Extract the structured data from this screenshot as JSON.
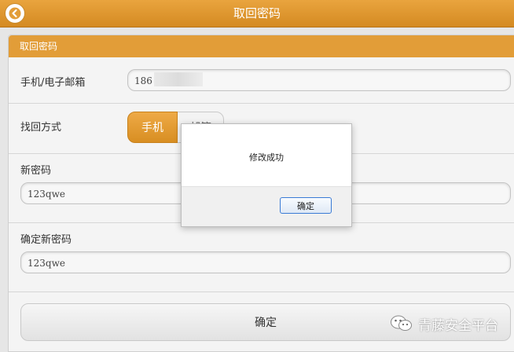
{
  "header": {
    "title": "取回密码",
    "back_icon": "back-arrow-icon"
  },
  "panel": {
    "title": "取回密码"
  },
  "form": {
    "account_label": "手机/电子邮箱",
    "account_value": "186",
    "method_label": "找回方式",
    "method_options": [
      "手机",
      "邮箱"
    ],
    "method_selected": "手机",
    "new_password_label": "新密码",
    "new_password_value": "123qwe",
    "confirm_password_label": "确定新密码",
    "confirm_password_value": "123qwe",
    "submit_label": "确定"
  },
  "dialog": {
    "message": "修改成功",
    "ok_label": "确定"
  },
  "watermark": {
    "text": "青藤安全平台",
    "icon": "wechat-icon"
  },
  "colors": {
    "accent": "#e29d38",
    "dialog_button_border": "#3a7bd5"
  }
}
